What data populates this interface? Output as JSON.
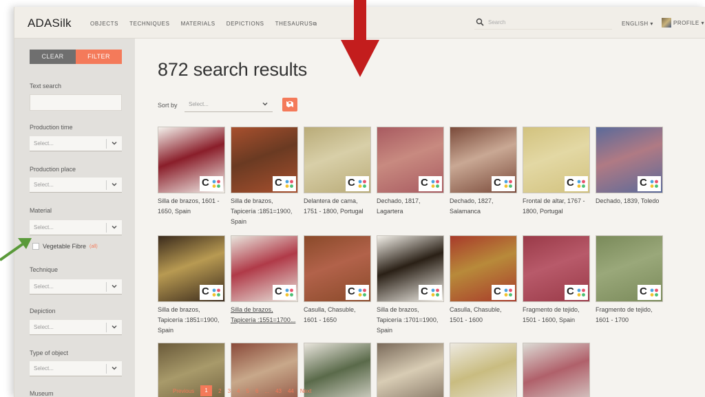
{
  "app": {
    "logo": "ADASilk",
    "nav": [
      "OBJECTS",
      "TECHNIQUES",
      "MATERIALS",
      "DEPICTIONS",
      "THESAURUS⧉"
    ],
    "search_placeholder": "Search",
    "language": "ENGLISH ▾",
    "profile": "PROFILE ▾"
  },
  "sidebar": {
    "clear_label": "CLEAR",
    "filter_label": "FILTER",
    "text_search_label": "Text search",
    "filters": [
      {
        "label": "Production time",
        "placeholder": "Select..."
      },
      {
        "label": "Production place",
        "placeholder": "Select..."
      },
      {
        "label": "Material",
        "placeholder": "Select..."
      },
      {
        "label": "Technique",
        "placeholder": "Select..."
      },
      {
        "label": "Depiction",
        "placeholder": "Select..."
      },
      {
        "label": "Type of object",
        "placeholder": "Select..."
      },
      {
        "label": "Museum",
        "placeholder": ""
      }
    ],
    "material_option": {
      "label": "Vegetable Fibre",
      "count": "(all)"
    }
  },
  "main": {
    "title": "872 search results",
    "sort_label": "Sort by",
    "sort_placeholder": "Select..."
  },
  "results": [
    {
      "caption": "Silla de brazos, 1601 - 1650, Spain",
      "colors": [
        "#8a1e2a",
        "#f3f1ec"
      ]
    },
    {
      "caption": "Silla de brazos, Tapicería :1851=1900, Spain",
      "colors": [
        "#6a3a22",
        "#a8502e"
      ]
    },
    {
      "caption": "Delantera de cama, 1751 - 1800, Portugal",
      "colors": [
        "#d8cfa8",
        "#b9ab78"
      ]
    },
    {
      "caption": "Dechado, 1817, Lagartera",
      "colors": [
        "#c88a80",
        "#a85a60"
      ]
    },
    {
      "caption": "Dechado, 1827, Salamanca",
      "colors": [
        "#c9a894",
        "#7a4a3a"
      ]
    },
    {
      "caption": "Frontal de altar, 1767 - 1800, Portugal",
      "colors": [
        "#e3d8a4",
        "#d2c27e"
      ]
    },
    {
      "caption": "Dechado, 1839, Toledo",
      "colors": [
        "#b07a84",
        "#5a6a9a"
      ]
    },
    {
      "caption": "Silla de brazos, Tapicería :1851=1900, Spain",
      "colors": [
        "#b89a52",
        "#3a2a1c"
      ]
    },
    {
      "caption": "Silla de brazos, Tapicería :1551=1700...",
      "colors": [
        "#b03a48",
        "#e8e4dc"
      ]
    },
    {
      "caption": "Casulla, Chasuble, 1601 - 1650",
      "colors": [
        "#b2624a",
        "#8a4a2a"
      ]
    },
    {
      "caption": "Silla de brazos, Tapicería :1701=1900, Spain",
      "colors": [
        "#2a2016",
        "#f2efe8"
      ]
    },
    {
      "caption": "Casulla, Chasuble, 1501 - 1600",
      "colors": [
        "#b88a3a",
        "#a83a2a"
      ]
    },
    {
      "caption": "Fragmento de tejido, 1501 - 1600, Spain",
      "colors": [
        "#b85a6a",
        "#9a3a48"
      ]
    },
    {
      "caption": "Fragmento de tejido, 1601 - 1700",
      "colors": [
        "#9aa87a",
        "#7a8a5a"
      ]
    },
    {
      "caption": "",
      "colors": [
        "#a89a6a",
        "#6a5a3a"
      ]
    },
    {
      "caption": "",
      "colors": [
        "#c8a88a",
        "#8a4a3a"
      ]
    },
    {
      "caption": "",
      "colors": [
        "#5a6a4a",
        "#e8e4dc"
      ]
    },
    {
      "caption": "",
      "colors": [
        "#d8ccb4",
        "#7a6a5a"
      ]
    },
    {
      "caption": "",
      "colors": [
        "#c9bc80",
        "#ede9e0"
      ]
    },
    {
      "caption": "",
      "colors": [
        "#b0606a",
        "#dcdad4"
      ]
    }
  ],
  "pagination": [
    "Previous",
    "1",
    "2",
    "3",
    "4",
    "5",
    "6",
    "...",
    "43",
    "44",
    "Next"
  ],
  "current_page": "1",
  "colors": {
    "accent": "#f47a5a",
    "arrow_red": "#c31d1d",
    "arrow_green": "#5a9a3a"
  }
}
